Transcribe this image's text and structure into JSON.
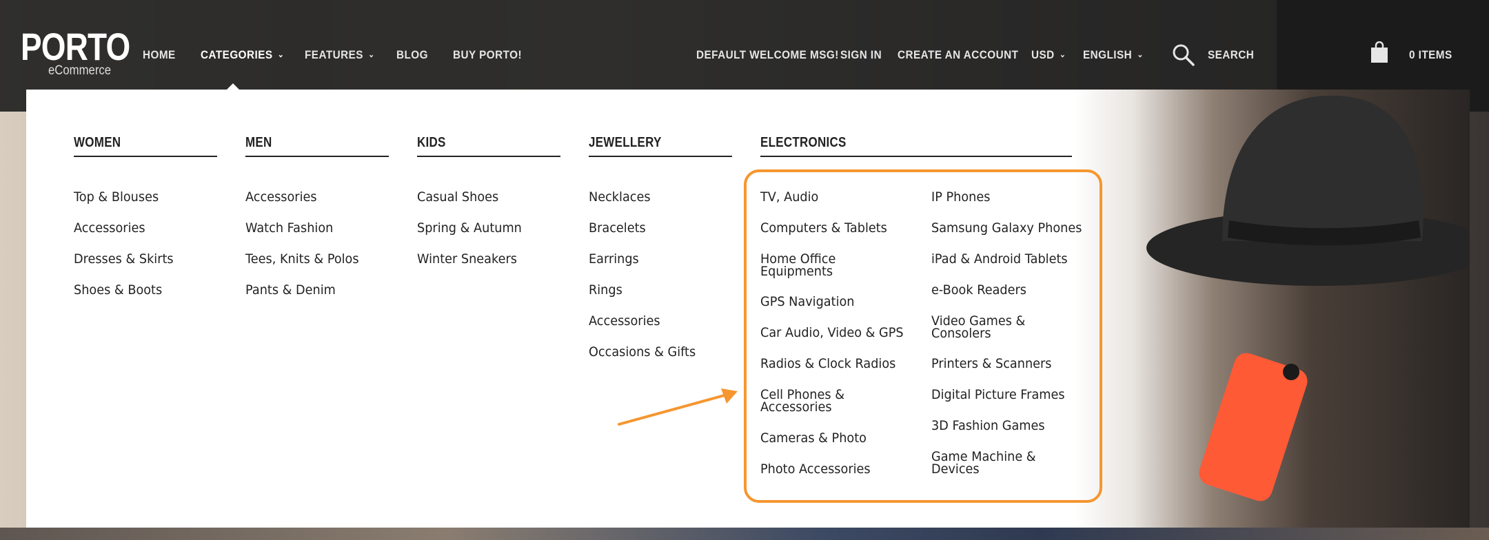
{
  "brand": {
    "name": "PORTO",
    "tagline": "eCommerce"
  },
  "nav": {
    "items": [
      {
        "label": "HOME"
      },
      {
        "label": "CATEGORIES",
        "active": true,
        "has_dropdown": true
      },
      {
        "label": "FEATURES",
        "has_dropdown": true
      },
      {
        "label": "BLOG"
      },
      {
        "label": "BUY PORTO!"
      }
    ]
  },
  "topbar": {
    "welcome": "DEFAULT WELCOME MSG!",
    "sign_in": "SIGN IN",
    "create_account": "CREATE AN ACCOUNT",
    "currency": "USD",
    "language": "ENGLISH",
    "search_label": "SEARCH",
    "cart_label": "0 ITEMS"
  },
  "menu": {
    "columns": [
      {
        "heading": "WOMEN",
        "links": [
          "Top & Blouses",
          "Accessories",
          "Dresses & Skirts",
          "Shoes & Boots"
        ]
      },
      {
        "heading": "MEN",
        "links": [
          "Accessories",
          "Watch Fashion",
          "Tees, Knits & Polos",
          "Pants & Denim"
        ]
      },
      {
        "heading": "KIDS",
        "links": [
          "Casual Shoes",
          "Spring & Autumn",
          "Winter Sneakers"
        ]
      },
      {
        "heading": "JEWELLERY",
        "links": [
          "Necklaces",
          "Bracelets",
          "Earrings",
          "Rings",
          "Accessories",
          "Occasions & Gifts"
        ]
      }
    ],
    "electronics": {
      "heading": "ELECTRONICS",
      "left": [
        "TV, Audio",
        "Computers & Tablets",
        "Home Office Equipments",
        "GPS Navigation",
        "Car Audio, Video & GPS",
        "Radios & Clock Radios",
        "Cell Phones & Accessories",
        "Cameras & Photo",
        "Photo Accessories"
      ],
      "right": [
        "IP Phones",
        "Samsung Galaxy Phones",
        "iPad & Android Tablets",
        "e-Book Readers",
        "Video Games & Consolers",
        "Printers & Scanners",
        "Digital Picture Frames",
        "3D Fashion Games",
        "Game Machine & Devices"
      ]
    }
  },
  "colors": {
    "header_bg": "#222222",
    "annotation": "#f5962f",
    "text": "#222222"
  }
}
